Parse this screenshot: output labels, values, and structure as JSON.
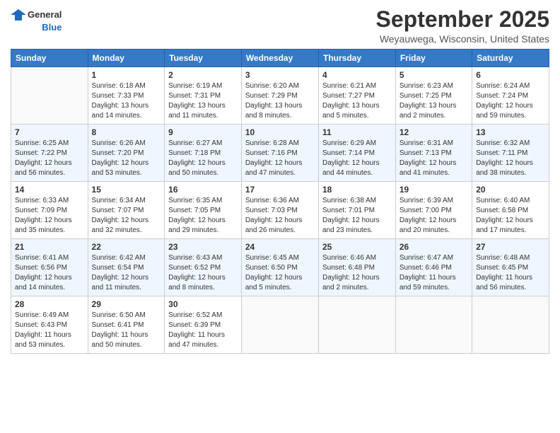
{
  "logo": {
    "line1": "General",
    "line2": "Blue"
  },
  "header": {
    "month": "September 2025",
    "location": "Weyauwega, Wisconsin, United States"
  },
  "weekdays": [
    "Sunday",
    "Monday",
    "Tuesday",
    "Wednesday",
    "Thursday",
    "Friday",
    "Saturday"
  ],
  "weeks": [
    [
      {
        "day": "",
        "info": ""
      },
      {
        "day": "1",
        "info": "Sunrise: 6:18 AM\nSunset: 7:33 PM\nDaylight: 13 hours\nand 14 minutes."
      },
      {
        "day": "2",
        "info": "Sunrise: 6:19 AM\nSunset: 7:31 PM\nDaylight: 13 hours\nand 11 minutes."
      },
      {
        "day": "3",
        "info": "Sunrise: 6:20 AM\nSunset: 7:29 PM\nDaylight: 13 hours\nand 8 minutes."
      },
      {
        "day": "4",
        "info": "Sunrise: 6:21 AM\nSunset: 7:27 PM\nDaylight: 13 hours\nand 5 minutes."
      },
      {
        "day": "5",
        "info": "Sunrise: 6:23 AM\nSunset: 7:25 PM\nDaylight: 13 hours\nand 2 minutes."
      },
      {
        "day": "6",
        "info": "Sunrise: 6:24 AM\nSunset: 7:24 PM\nDaylight: 12 hours\nand 59 minutes."
      }
    ],
    [
      {
        "day": "7",
        "info": "Sunrise: 6:25 AM\nSunset: 7:22 PM\nDaylight: 12 hours\nand 56 minutes."
      },
      {
        "day": "8",
        "info": "Sunrise: 6:26 AM\nSunset: 7:20 PM\nDaylight: 12 hours\nand 53 minutes."
      },
      {
        "day": "9",
        "info": "Sunrise: 6:27 AM\nSunset: 7:18 PM\nDaylight: 12 hours\nand 50 minutes."
      },
      {
        "day": "10",
        "info": "Sunrise: 6:28 AM\nSunset: 7:16 PM\nDaylight: 12 hours\nand 47 minutes."
      },
      {
        "day": "11",
        "info": "Sunrise: 6:29 AM\nSunset: 7:14 PM\nDaylight: 12 hours\nand 44 minutes."
      },
      {
        "day": "12",
        "info": "Sunrise: 6:31 AM\nSunset: 7:13 PM\nDaylight: 12 hours\nand 41 minutes."
      },
      {
        "day": "13",
        "info": "Sunrise: 6:32 AM\nSunset: 7:11 PM\nDaylight: 12 hours\nand 38 minutes."
      }
    ],
    [
      {
        "day": "14",
        "info": "Sunrise: 6:33 AM\nSunset: 7:09 PM\nDaylight: 12 hours\nand 35 minutes."
      },
      {
        "day": "15",
        "info": "Sunrise: 6:34 AM\nSunset: 7:07 PM\nDaylight: 12 hours\nand 32 minutes."
      },
      {
        "day": "16",
        "info": "Sunrise: 6:35 AM\nSunset: 7:05 PM\nDaylight: 12 hours\nand 29 minutes."
      },
      {
        "day": "17",
        "info": "Sunrise: 6:36 AM\nSunset: 7:03 PM\nDaylight: 12 hours\nand 26 minutes."
      },
      {
        "day": "18",
        "info": "Sunrise: 6:38 AM\nSunset: 7:01 PM\nDaylight: 12 hours\nand 23 minutes."
      },
      {
        "day": "19",
        "info": "Sunrise: 6:39 AM\nSunset: 7:00 PM\nDaylight: 12 hours\nand 20 minutes."
      },
      {
        "day": "20",
        "info": "Sunrise: 6:40 AM\nSunset: 6:58 PM\nDaylight: 12 hours\nand 17 minutes."
      }
    ],
    [
      {
        "day": "21",
        "info": "Sunrise: 6:41 AM\nSunset: 6:56 PM\nDaylight: 12 hours\nand 14 minutes."
      },
      {
        "day": "22",
        "info": "Sunrise: 6:42 AM\nSunset: 6:54 PM\nDaylight: 12 hours\nand 11 minutes."
      },
      {
        "day": "23",
        "info": "Sunrise: 6:43 AM\nSunset: 6:52 PM\nDaylight: 12 hours\nand 8 minutes."
      },
      {
        "day": "24",
        "info": "Sunrise: 6:45 AM\nSunset: 6:50 PM\nDaylight: 12 hours\nand 5 minutes."
      },
      {
        "day": "25",
        "info": "Sunrise: 6:46 AM\nSunset: 6:48 PM\nDaylight: 12 hours\nand 2 minutes."
      },
      {
        "day": "26",
        "info": "Sunrise: 6:47 AM\nSunset: 6:46 PM\nDaylight: 11 hours\nand 59 minutes."
      },
      {
        "day": "27",
        "info": "Sunrise: 6:48 AM\nSunset: 6:45 PM\nDaylight: 11 hours\nand 56 minutes."
      }
    ],
    [
      {
        "day": "28",
        "info": "Sunrise: 6:49 AM\nSunset: 6:43 PM\nDaylight: 11 hours\nand 53 minutes."
      },
      {
        "day": "29",
        "info": "Sunrise: 6:50 AM\nSunset: 6:41 PM\nDaylight: 11 hours\nand 50 minutes."
      },
      {
        "day": "30",
        "info": "Sunrise: 6:52 AM\nSunset: 6:39 PM\nDaylight: 11 hours\nand 47 minutes."
      },
      {
        "day": "",
        "info": ""
      },
      {
        "day": "",
        "info": ""
      },
      {
        "day": "",
        "info": ""
      },
      {
        "day": "",
        "info": ""
      }
    ]
  ]
}
